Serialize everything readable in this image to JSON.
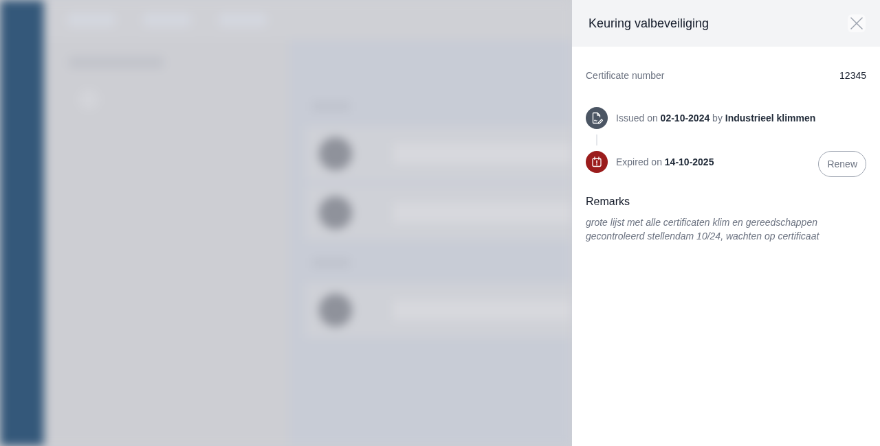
{
  "panel": {
    "title": "Keuring valbeveiliging"
  },
  "details": [
    {
      "label": "Certificate number",
      "value": "12345"
    }
  ],
  "timeline": [
    {
      "kind": "issued",
      "text": "Issued on **02-10-2024** by **Industrieel klimmen**"
    },
    {
      "kind": "expired",
      "text": "Expired on **14-10-2025**",
      "action": "Renew"
    }
  ],
  "remarks": {
    "heading": "Remarks",
    "text": "grote lijst met alle certificaten klim en gereedschappen\ngecontroleerd stellendam 10/24, wachten op certificaat"
  }
}
